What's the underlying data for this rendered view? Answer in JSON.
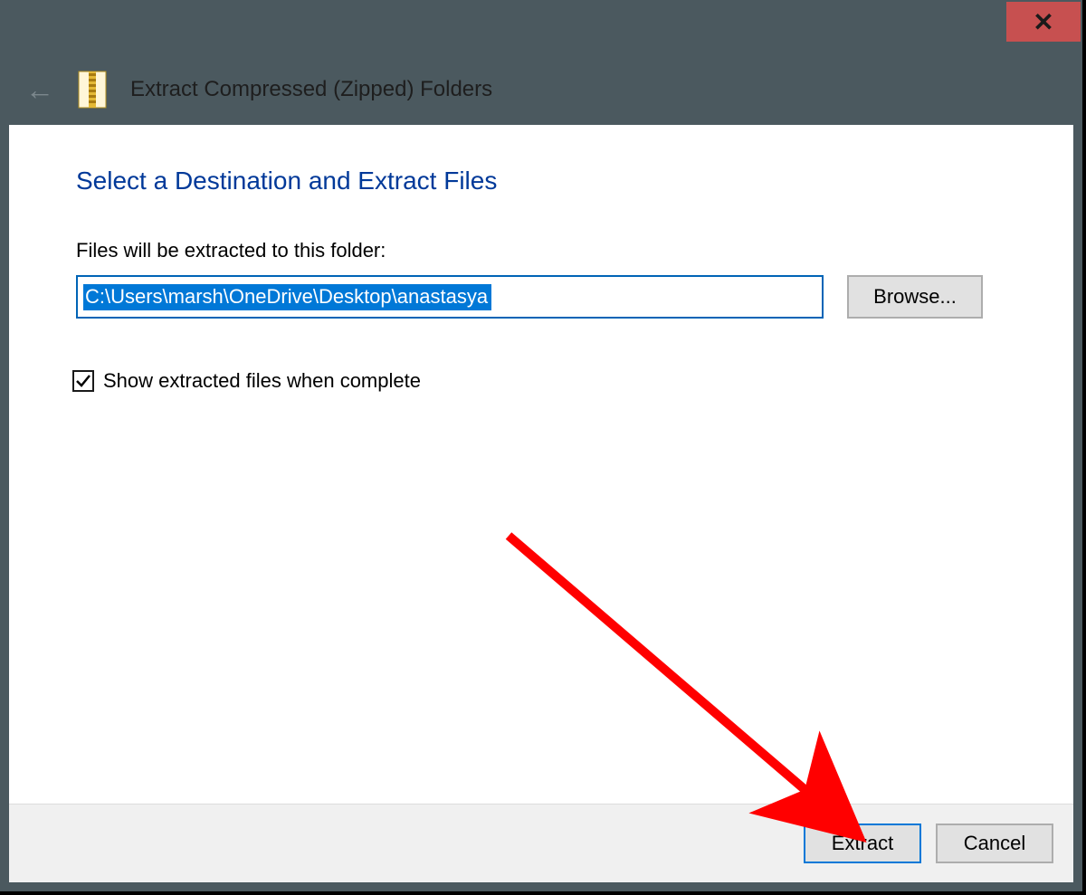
{
  "header": {
    "title": "Extract Compressed (Zipped) Folders"
  },
  "page": {
    "heading": "Select a Destination and Extract Files",
    "folder_label": "Files will be extracted to this folder:",
    "path_value": "C:\\Users\\marsh\\OneDrive\\Desktop\\anastasya",
    "browse_label": "Browse...",
    "checkbox_label": "Show extracted files when complete",
    "checkbox_checked": true
  },
  "footer": {
    "extract_label": "Extract",
    "cancel_label": "Cancel"
  }
}
